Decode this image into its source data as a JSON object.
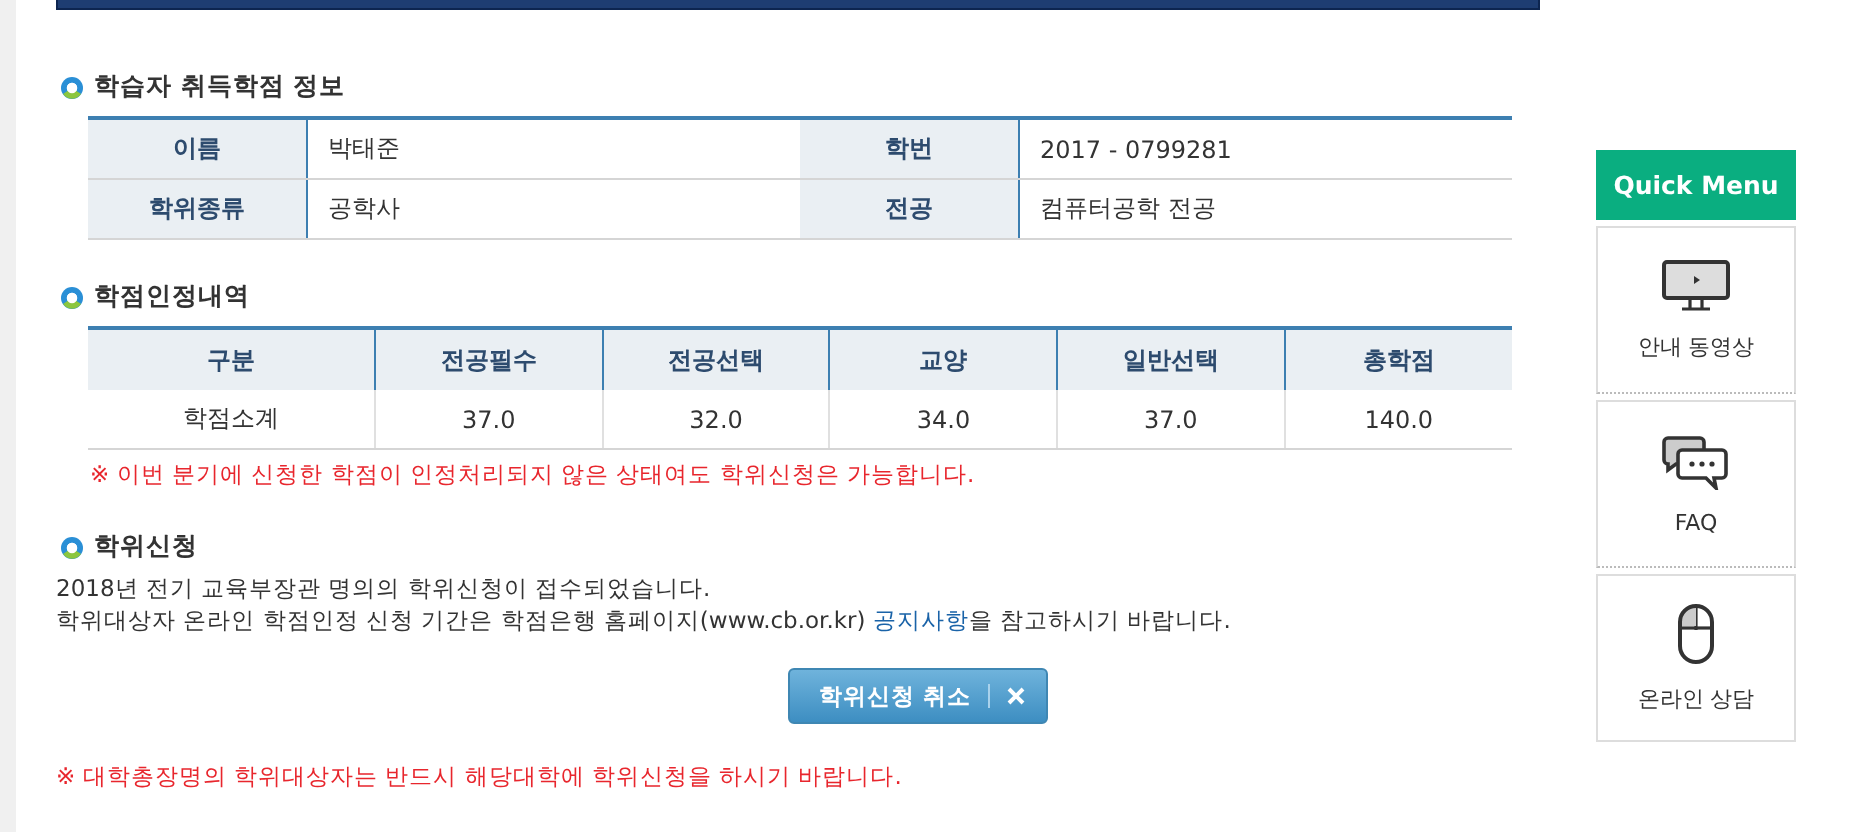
{
  "learner_info": {
    "title": "학습자 취득학점 정보",
    "rows": [
      [
        {
          "label": "이름",
          "value": "박태준"
        },
        {
          "label": "학번",
          "value": "2017 - 0799281"
        }
      ],
      [
        {
          "label": "학위종류",
          "value": "공학사"
        },
        {
          "label": "전공",
          "value": "컴퓨터공학 전공"
        }
      ]
    ]
  },
  "credits": {
    "title": "학점인정내역",
    "columns": [
      "구분",
      "전공필수",
      "전공선택",
      "교양",
      "일반선택",
      "총학점"
    ],
    "rows": [
      [
        "학점소계",
        "37.0",
        "32.0",
        "34.0",
        "37.0",
        "140.0"
      ]
    ],
    "note": "※ 이번 분기에 신청한 학점이 인정처리되지 않은 상태여도 학위신청은 가능합니다."
  },
  "degree_application": {
    "title": "학위신청",
    "lines": [
      "2018년 전기 교육부장관 명의의 학위신청이 접수되었습니다.",
      {
        "before": "학위대상자 온라인 학점인정 신청 기간은 학점은행 홈페이지(www.cb.or.kr) ",
        "link": "공지사항",
        "after": "을 참고하시기 바랍니다."
      }
    ],
    "button": "학위신청 취소",
    "note": "※ 대학총장명의 학위대상자는 반드시 해당대학에 학위신청을 하시기 바랍니다."
  },
  "quick_menu": {
    "title": "Quick Menu",
    "items": [
      {
        "kind": "video",
        "label": "안내 동영상"
      },
      {
        "kind": "faq",
        "label": "FAQ"
      },
      {
        "kind": "chat",
        "label": "온라인 상담"
      }
    ]
  }
}
